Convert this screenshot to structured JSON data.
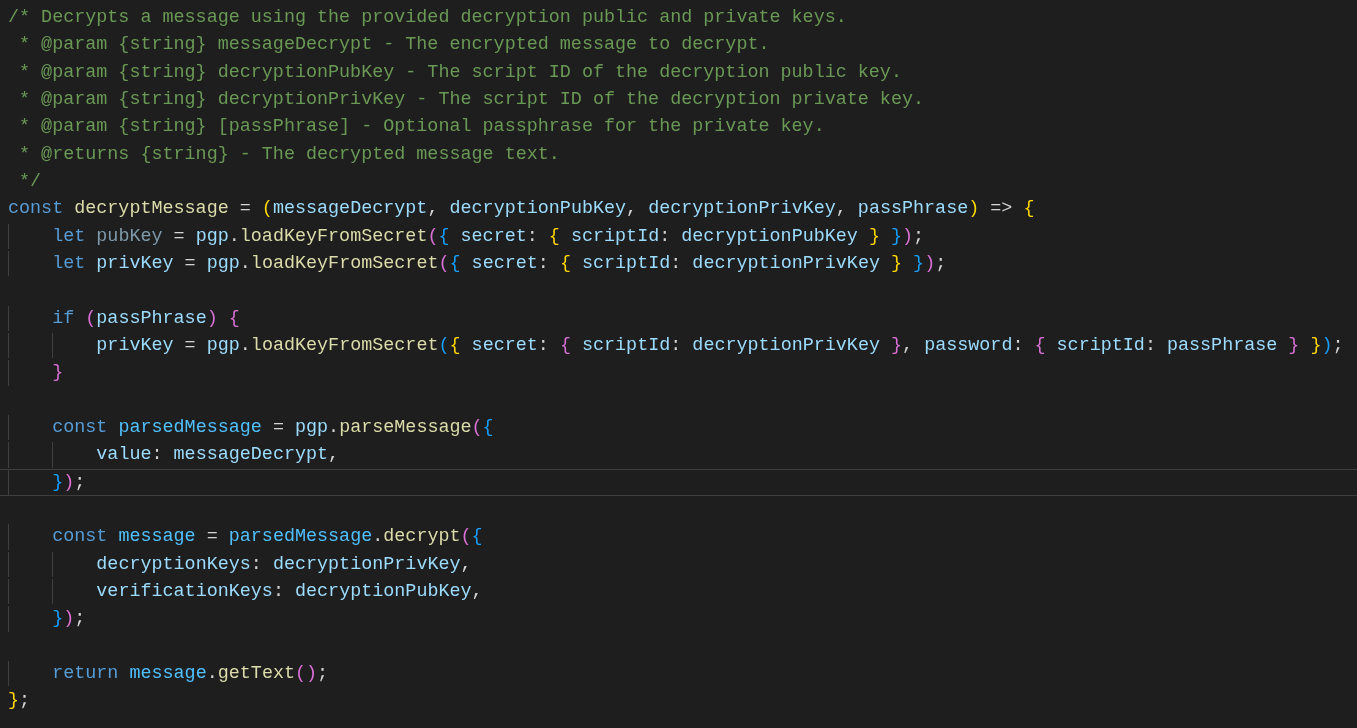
{
  "editor": {
    "lines": [
      {
        "current": false,
        "tokens": [
          {
            "kind": "comment",
            "text": "/* Decrypts a message using the provided decryption public and private keys."
          }
        ]
      },
      {
        "current": false,
        "tokens": [
          {
            "kind": "comment",
            "text": " * @param {string} messageDecrypt - The encrypted message to decrypt."
          }
        ]
      },
      {
        "current": false,
        "tokens": [
          {
            "kind": "comment",
            "text": " * @param {string} decryptionPubKey - The script ID of the decryption public key."
          }
        ]
      },
      {
        "current": false,
        "tokens": [
          {
            "kind": "comment",
            "text": " * @param {string} decryptionPrivKey - The script ID of the decryption private key."
          }
        ]
      },
      {
        "current": false,
        "tokens": [
          {
            "kind": "comment",
            "text": " * @param {string} [passPhrase] - Optional passphrase for the private key."
          }
        ]
      },
      {
        "current": false,
        "tokens": [
          {
            "kind": "comment",
            "text": " * @returns {string} - The decrypted message text."
          }
        ]
      },
      {
        "current": false,
        "tokens": [
          {
            "kind": "comment",
            "text": " */"
          }
        ]
      },
      {
        "current": false,
        "tokens": [
          {
            "kind": "keyword",
            "text": "const "
          },
          {
            "kind": "function",
            "text": "decryptMessage"
          },
          {
            "kind": "plain",
            "text": " = "
          },
          {
            "kind": "bracket1",
            "text": "("
          },
          {
            "kind": "variable",
            "text": "messageDecrypt"
          },
          {
            "kind": "plain",
            "text": ", "
          },
          {
            "kind": "variable",
            "text": "decryptionPubKey"
          },
          {
            "kind": "plain",
            "text": ", "
          },
          {
            "kind": "variable",
            "text": "decryptionPrivKey"
          },
          {
            "kind": "plain",
            "text": ", "
          },
          {
            "kind": "variable",
            "text": "passPhrase"
          },
          {
            "kind": "bracket1",
            "text": ") "
          },
          {
            "kind": "plain",
            "text": "=> "
          },
          {
            "kind": "bracket1",
            "text": "{"
          }
        ]
      },
      {
        "current": false,
        "tokens": [
          {
            "kind": "keyword",
            "text": "    let "
          },
          {
            "kind": "unused",
            "text": "pubKey"
          },
          {
            "kind": "plain",
            "text": " = "
          },
          {
            "kind": "variable",
            "text": "pgp"
          },
          {
            "kind": "plain",
            "text": "."
          },
          {
            "kind": "function",
            "text": "loadKeyFromSecret"
          },
          {
            "kind": "bracket2",
            "text": "("
          },
          {
            "kind": "bracket3",
            "text": "{ "
          },
          {
            "kind": "variable",
            "text": "secret"
          },
          {
            "kind": "plain",
            "text": ": "
          },
          {
            "kind": "bracket1",
            "text": "{ "
          },
          {
            "kind": "variable",
            "text": "scriptId"
          },
          {
            "kind": "plain",
            "text": ": "
          },
          {
            "kind": "variable",
            "text": "decryptionPubKey "
          },
          {
            "kind": "bracket1",
            "text": "} "
          },
          {
            "kind": "bracket3",
            "text": "}"
          },
          {
            "kind": "bracket2",
            "text": ")"
          },
          {
            "kind": "plain",
            "text": ";"
          }
        ]
      },
      {
        "current": false,
        "tokens": [
          {
            "kind": "keyword",
            "text": "    let "
          },
          {
            "kind": "variable",
            "text": "privKey"
          },
          {
            "kind": "plain",
            "text": " = "
          },
          {
            "kind": "variable",
            "text": "pgp"
          },
          {
            "kind": "plain",
            "text": "."
          },
          {
            "kind": "function",
            "text": "loadKeyFromSecret"
          },
          {
            "kind": "bracket2",
            "text": "("
          },
          {
            "kind": "bracket3",
            "text": "{ "
          },
          {
            "kind": "variable",
            "text": "secret"
          },
          {
            "kind": "plain",
            "text": ": "
          },
          {
            "kind": "bracket1",
            "text": "{ "
          },
          {
            "kind": "variable",
            "text": "scriptId"
          },
          {
            "kind": "plain",
            "text": ": "
          },
          {
            "kind": "variable",
            "text": "decryptionPrivKey "
          },
          {
            "kind": "bracket1",
            "text": "} "
          },
          {
            "kind": "bracket3",
            "text": "}"
          },
          {
            "kind": "bracket2",
            "text": ")"
          },
          {
            "kind": "plain",
            "text": ";"
          }
        ]
      },
      {
        "current": false
      },
      {
        "current": false,
        "tokens": [
          {
            "kind": "keyword",
            "text": "    if "
          },
          {
            "kind": "bracket2",
            "text": "("
          },
          {
            "kind": "variable",
            "text": "passPhrase"
          },
          {
            "kind": "bracket2",
            "text": ") "
          },
          {
            "kind": "bracket2",
            "text": "{"
          }
        ]
      },
      {
        "current": false,
        "tokens": [
          {
            "kind": "variable",
            "text": "        privKey"
          },
          {
            "kind": "plain",
            "text": " = "
          },
          {
            "kind": "variable",
            "text": "pgp"
          },
          {
            "kind": "plain",
            "text": "."
          },
          {
            "kind": "function",
            "text": "loadKeyFromSecret"
          },
          {
            "kind": "bracket3",
            "text": "("
          },
          {
            "kind": "bracket1",
            "text": "{ "
          },
          {
            "kind": "variable",
            "text": "secret"
          },
          {
            "kind": "plain",
            "text": ": "
          },
          {
            "kind": "bracket2",
            "text": "{ "
          },
          {
            "kind": "variable",
            "text": "scriptId"
          },
          {
            "kind": "plain",
            "text": ": "
          },
          {
            "kind": "variable",
            "text": "decryptionPrivKey "
          },
          {
            "kind": "bracket2",
            "text": "}"
          },
          {
            "kind": "plain",
            "text": ", "
          },
          {
            "kind": "variable",
            "text": "password"
          },
          {
            "kind": "plain",
            "text": ": "
          },
          {
            "kind": "bracket2",
            "text": "{ "
          },
          {
            "kind": "variable",
            "text": "scriptId"
          },
          {
            "kind": "plain",
            "text": ": "
          },
          {
            "kind": "variable",
            "text": "passPhrase "
          },
          {
            "kind": "bracket2",
            "text": "} "
          },
          {
            "kind": "bracket1",
            "text": "}"
          },
          {
            "kind": "bracket3",
            "text": ")"
          },
          {
            "kind": "plain",
            "text": ";"
          }
        ]
      },
      {
        "current": false,
        "tokens": [
          {
            "kind": "bracket2",
            "text": "    }"
          }
        ]
      },
      {
        "current": false
      },
      {
        "current": false,
        "tokens": [
          {
            "kind": "keyword",
            "text": "    const "
          },
          {
            "kind": "constant",
            "text": "parsedMessage"
          },
          {
            "kind": "plain",
            "text": " = "
          },
          {
            "kind": "variable",
            "text": "pgp"
          },
          {
            "kind": "plain",
            "text": "."
          },
          {
            "kind": "function",
            "text": "parseMessage"
          },
          {
            "kind": "bracket2",
            "text": "("
          },
          {
            "kind": "bracket3",
            "text": "{"
          }
        ]
      },
      {
        "current": false,
        "tokens": [
          {
            "kind": "variable",
            "text": "        value"
          },
          {
            "kind": "plain",
            "text": ": "
          },
          {
            "kind": "variable",
            "text": "messageDecrypt"
          },
          {
            "kind": "plain",
            "text": ","
          }
        ]
      },
      {
        "current": true,
        "tokens": [
          {
            "kind": "bracket3",
            "text": "    }"
          },
          {
            "kind": "bracket2",
            "text": ")"
          },
          {
            "kind": "plain",
            "text": ";"
          }
        ]
      },
      {
        "current": false
      },
      {
        "current": false,
        "tokens": [
          {
            "kind": "keyword",
            "text": "    const "
          },
          {
            "kind": "constant",
            "text": "message"
          },
          {
            "kind": "plain",
            "text": " = "
          },
          {
            "kind": "constant",
            "text": "parsedMessage"
          },
          {
            "kind": "plain",
            "text": "."
          },
          {
            "kind": "function",
            "text": "decrypt"
          },
          {
            "kind": "bracket2",
            "text": "("
          },
          {
            "kind": "bracket3",
            "text": "{"
          }
        ]
      },
      {
        "current": false,
        "tokens": [
          {
            "kind": "variable",
            "text": "        decryptionKeys"
          },
          {
            "kind": "plain",
            "text": ": "
          },
          {
            "kind": "variable",
            "text": "decryptionPrivKey"
          },
          {
            "kind": "plain",
            "text": ","
          }
        ]
      },
      {
        "current": false,
        "tokens": [
          {
            "kind": "variable",
            "text": "        verificationKeys"
          },
          {
            "kind": "plain",
            "text": ": "
          },
          {
            "kind": "variable",
            "text": "decryptionPubKey"
          },
          {
            "kind": "plain",
            "text": ","
          }
        ]
      },
      {
        "current": false,
        "tokens": [
          {
            "kind": "bracket3",
            "text": "    }"
          },
          {
            "kind": "bracket2",
            "text": ")"
          },
          {
            "kind": "plain",
            "text": ";"
          }
        ]
      },
      {
        "current": false
      },
      {
        "current": false,
        "tokens": [
          {
            "kind": "keyword",
            "text": "    return "
          },
          {
            "kind": "constant",
            "text": "message"
          },
          {
            "kind": "plain",
            "text": "."
          },
          {
            "kind": "function",
            "text": "getText"
          },
          {
            "kind": "bracket2",
            "text": "()"
          },
          {
            "kind": "plain",
            "text": ";"
          }
        ]
      },
      {
        "current": false,
        "tokens": [
          {
            "kind": "bracket1",
            "text": "}"
          },
          {
            "kind": "plain",
            "text": ";"
          }
        ]
      }
    ]
  }
}
